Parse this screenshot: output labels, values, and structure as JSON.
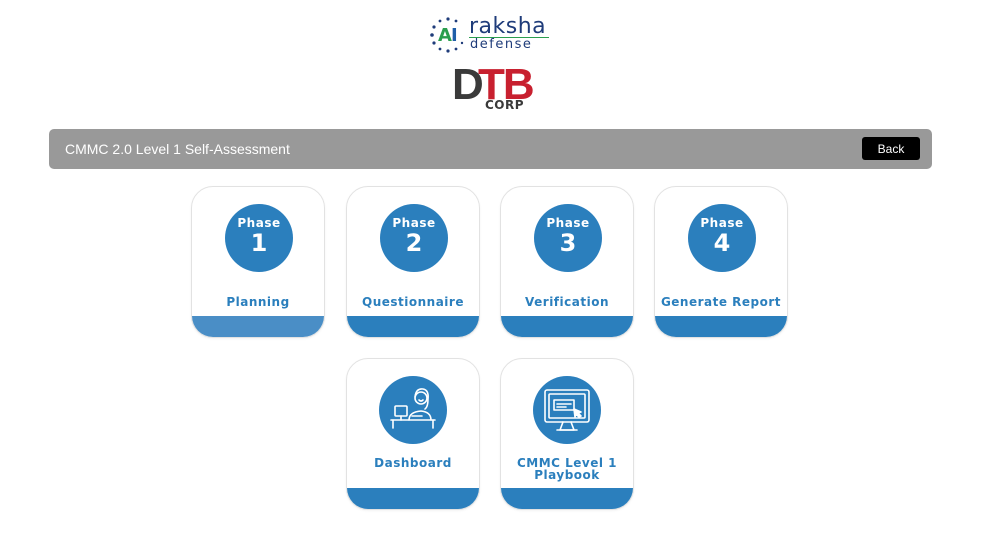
{
  "logos": {
    "ai": {
      "a": "A",
      "i": "I",
      "name": "raksha",
      "tagline": "defense"
    },
    "dtb": {
      "d": "D",
      "tb": "TB",
      "sub": "CORP"
    }
  },
  "header": {
    "title": "CMMC 2.0 Level 1 Self-Assessment",
    "back_label": "Back"
  },
  "phases": [
    {
      "word": "Phase",
      "number": "1",
      "label": "Planning"
    },
    {
      "word": "Phase",
      "number": "2",
      "label": "Questionnaire"
    },
    {
      "word": "Phase",
      "number": "3",
      "label": "Verification"
    },
    {
      "word": "Phase",
      "number": "4",
      "label": "Generate Report"
    }
  ],
  "tools": [
    {
      "label": "Dashboard",
      "icon": "person-at-desk-icon"
    },
    {
      "label_line1": "CMMC Level 1",
      "label_line2": "Playbook",
      "icon": "monitor-document-icon"
    }
  ],
  "colors": {
    "accent": "#2b7fbd",
    "header_bg": "#999999",
    "back_button_bg": "#000000",
    "brand_green": "#2b9e4e",
    "brand_navy": "#1f3c7a",
    "brand_red": "#c8202f"
  }
}
